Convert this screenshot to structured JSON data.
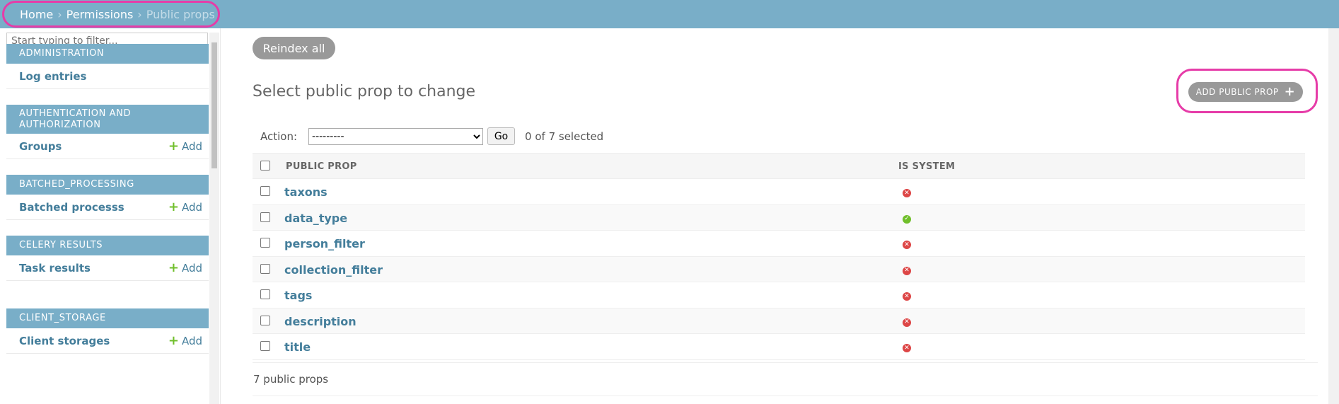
{
  "breadcrumbs": {
    "home": "Home",
    "sep": "›",
    "section": "Permissions",
    "current": "Public props"
  },
  "sidebar": {
    "filter_placeholder": "Start typing to filter...",
    "add_label": "Add",
    "modules": [
      {
        "title": "ADMINISTRATION",
        "model": "Log entries",
        "has_add": false
      },
      {
        "title": "AUTHENTICATION AND AUTHORIZATION",
        "model": "Groups",
        "has_add": true
      },
      {
        "title": "BATCHED_PROCESSING",
        "model": "Batched processs",
        "has_add": true
      },
      {
        "title": "CELERY RESULTS",
        "model": "Task results",
        "has_add": true
      },
      {
        "title": "CLIENT_STORAGE",
        "model": "Client storages",
        "has_add": true
      }
    ]
  },
  "main": {
    "reindex_label": "Reindex all",
    "title": "Select public prop to change",
    "add_button": "ADD PUBLIC PROP",
    "action_label": "Action:",
    "action_selected": "---------",
    "go_label": "Go",
    "selection_counter": "0 of 7 selected",
    "columns": [
      "PUBLIC PROP",
      "IS SYSTEM"
    ],
    "rows": [
      {
        "name": "taxons",
        "is_system": false
      },
      {
        "name": "data_type",
        "is_system": true
      },
      {
        "name": "person_filter",
        "is_system": false
      },
      {
        "name": "collection_filter",
        "is_system": false
      },
      {
        "name": "tags",
        "is_system": false
      },
      {
        "name": "description",
        "is_system": false
      },
      {
        "name": "title",
        "is_system": false
      }
    ],
    "paginator": "7 public props"
  },
  "colors": {
    "header": "#79aec8",
    "link": "#447e9b",
    "highlight": "#e63ca8",
    "yes": "#70bf2b",
    "no": "#dd4646"
  }
}
